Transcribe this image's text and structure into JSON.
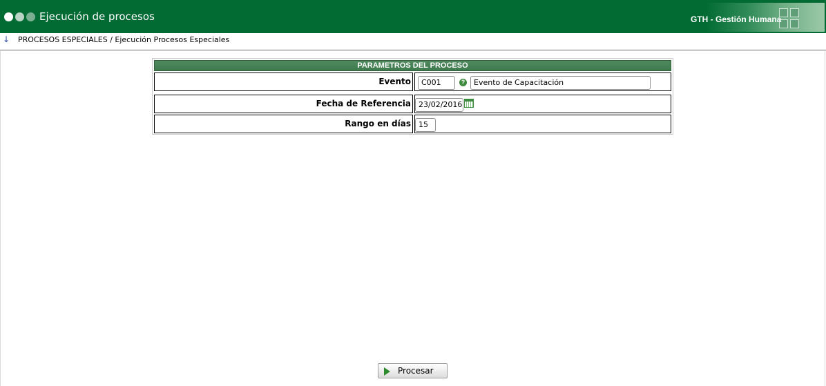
{
  "header": {
    "title": "Ejecución de procesos",
    "brand": "GTH - Gestión Humana",
    "bg_color": "#026b34"
  },
  "breadcrumb": {
    "icon": "down-arrow-icon",
    "text": "PROCESOS ESPECIALES / Ejecución Procesos Especiales"
  },
  "panel": {
    "title": "PARAMETROS DEL PROCESO",
    "rows": [
      {
        "label": "Evento",
        "code": "C001",
        "description": "Evento de Capacitación"
      },
      {
        "label": "Fecha de Referencia",
        "value": "23/02/2016"
      },
      {
        "label": "Rango en días",
        "value": "15"
      }
    ]
  },
  "actions": {
    "process_label": "Procesar",
    "process_icon": "play-icon"
  },
  "icons": {
    "help": "?"
  }
}
